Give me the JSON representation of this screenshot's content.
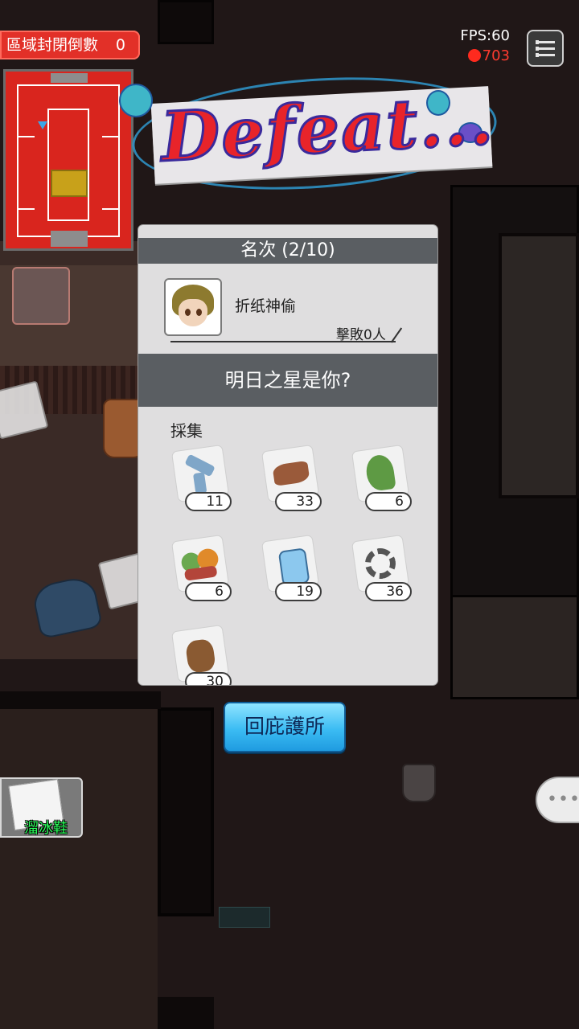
{
  "hud": {
    "countdown_label": "區域封閉倒數",
    "countdown_value": "0",
    "fps": "FPS:60",
    "ping": "703"
  },
  "result": {
    "title": "Defeat...",
    "rank_header": "名次 (2/10)",
    "player_name": "折纸神偷",
    "kills": "擊敗0人",
    "slogan": "明日之星是你?",
    "section_label": "採集",
    "items": [
      {
        "name": "pipe",
        "count": "11"
      },
      {
        "name": "leather",
        "count": "33"
      },
      {
        "name": "herbs",
        "count": "6"
      },
      {
        "name": "food",
        "count": "6"
      },
      {
        "name": "water-bottle",
        "count": "19"
      },
      {
        "name": "gear",
        "count": "36"
      },
      {
        "name": "wood",
        "count": "30"
      }
    ]
  },
  "actions": {
    "return_shelter": "回庇護所"
  },
  "equipped_item": {
    "label": "溜冰鞋"
  },
  "colors": {
    "alert_red": "#e23028",
    "button_blue": "#3bbcf3",
    "panel_header": "#5a5e62",
    "item_label_green": "#2aff5a"
  }
}
